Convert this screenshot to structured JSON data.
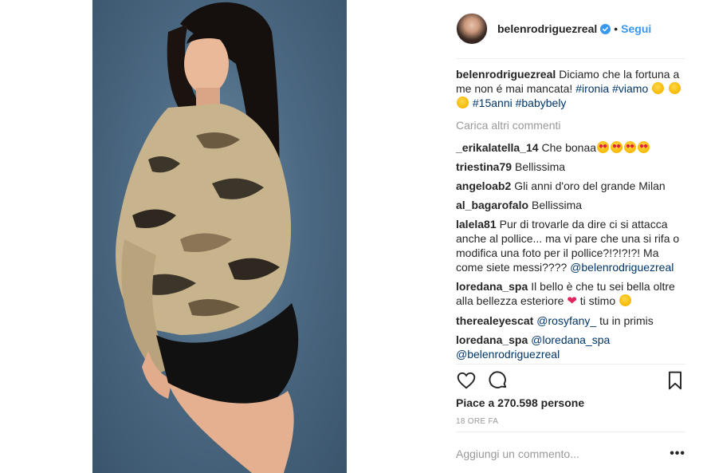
{
  "post": {
    "username": "belenrodriguezreal",
    "follow_label": "Segui",
    "separator": "•",
    "caption": {
      "text": "Diciamo che la fortuna a me non é mai mancata!",
      "tags": [
        "#ironia",
        "#viamo",
        "#15anni",
        "#babybely"
      ]
    },
    "load_more_label": "Carica altri commenti",
    "comments": [
      {
        "user": "_erikalatella_14",
        "text": "Che bonaa"
      },
      {
        "user": "triestina79",
        "text": "Bellissima"
      },
      {
        "user": "angeloab2",
        "text": "Gli anni d'oro del grande Milan"
      },
      {
        "user": "al_bagarofalo",
        "text": "Bellissima"
      },
      {
        "user": "lalela81",
        "text": "Pur di trovarle da dire ci si attacca anche al pollice... ma vi pare che una si rifa o modifica una foto per il pollice?!?!?!?! Ma come siete messi????",
        "mention": "@belenrodriguezreal"
      },
      {
        "user": "loredana_spa",
        "text": "Il bello è che tu sei bella oltre alla bellezza esteriore",
        "text_after": "ti stimo"
      },
      {
        "user": "therealeyescat",
        "mention": "@rosyfany_",
        "text_after": "tu in primis"
      },
      {
        "user": "loredana_spa",
        "mention": "@loredana_spa",
        "mention2": "@belenrodriguezreal"
      }
    ],
    "likes_label": "Piace a 270.598 persone",
    "time_label": "18 ORE FA",
    "add_comment_placeholder": "Aggiungi un commento...",
    "more_label": "•••"
  },
  "icons": {
    "like": "heart-outline-icon",
    "comment": "speech-bubble-icon",
    "save": "bookmark-icon",
    "verified": "verified-badge-icon"
  },
  "colors": {
    "link": "#3897f0",
    "hashtag": "#003569",
    "muted": "#999999",
    "text": "#262626"
  }
}
